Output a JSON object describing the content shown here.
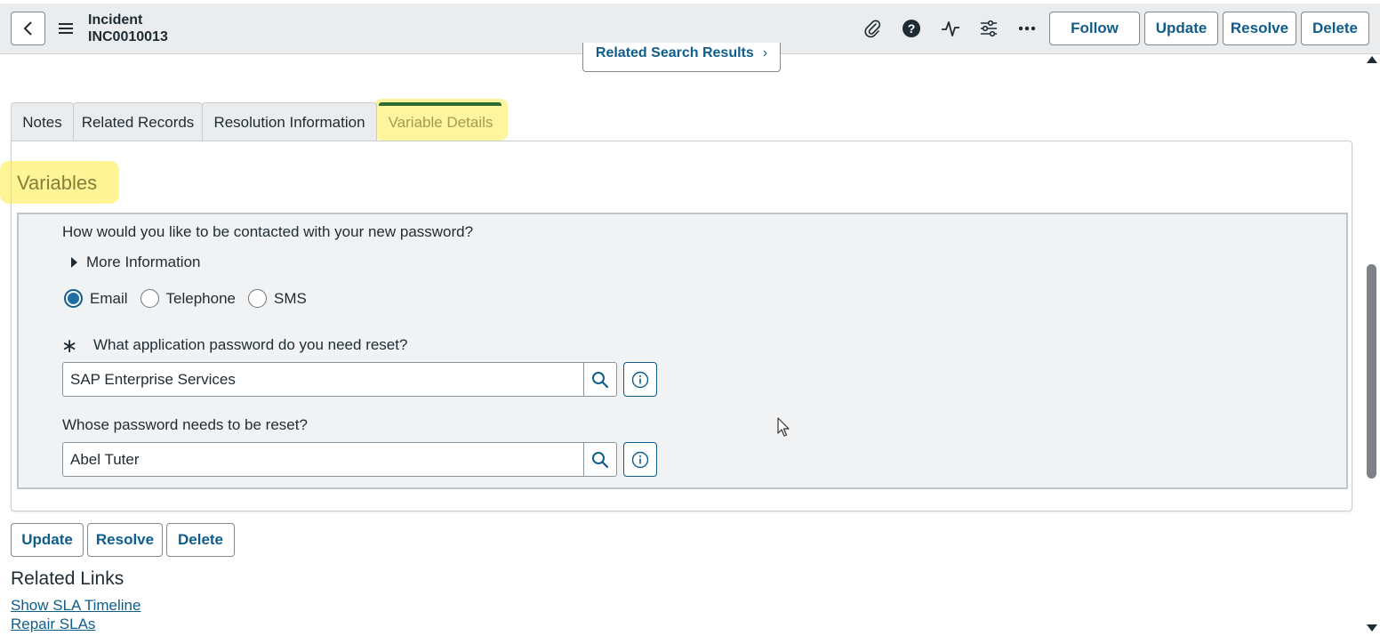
{
  "header": {
    "record_type": "Incident",
    "record_number": "INC0010013",
    "icons": [
      "back-icon",
      "menu-icon",
      "paperclip-icon",
      "help-icon",
      "activity-icon",
      "settings-sliders-icon",
      "more-icon"
    ],
    "buttons": {
      "follow": "Follow",
      "update": "Update",
      "resolve": "Resolve",
      "delete": "Delete"
    }
  },
  "related_search": {
    "label": "Related Search Results",
    "chevron": "›"
  },
  "tabs": [
    {
      "label": "Notes"
    },
    {
      "label": "Related Records"
    },
    {
      "label": "Resolution Information"
    },
    {
      "label": "Variable Details",
      "active": true
    }
  ],
  "variables": {
    "title": "Variables",
    "contact_question": "How would you like to be contacted with your new password?",
    "more_info": "More Information",
    "contact_options": [
      "Email",
      "Telephone",
      "SMS"
    ],
    "contact_selected": "Email",
    "app_question": "What application password do you need reset?",
    "app_required_mark": "∗",
    "app_value": "SAP Enterprise Services",
    "user_question": "Whose password needs to be reset?",
    "user_value": "Abel Tuter"
  },
  "footer_buttons": {
    "update": "Update",
    "resolve": "Resolve",
    "delete": "Delete"
  },
  "related_links": {
    "title": "Related Links",
    "links": [
      "Show SLA Timeline",
      "Repair SLAs"
    ]
  },
  "colors": {
    "accent": "#0e5d8c",
    "highlight": "#ffec50",
    "active_tab_bar": "#2c6e2f"
  }
}
